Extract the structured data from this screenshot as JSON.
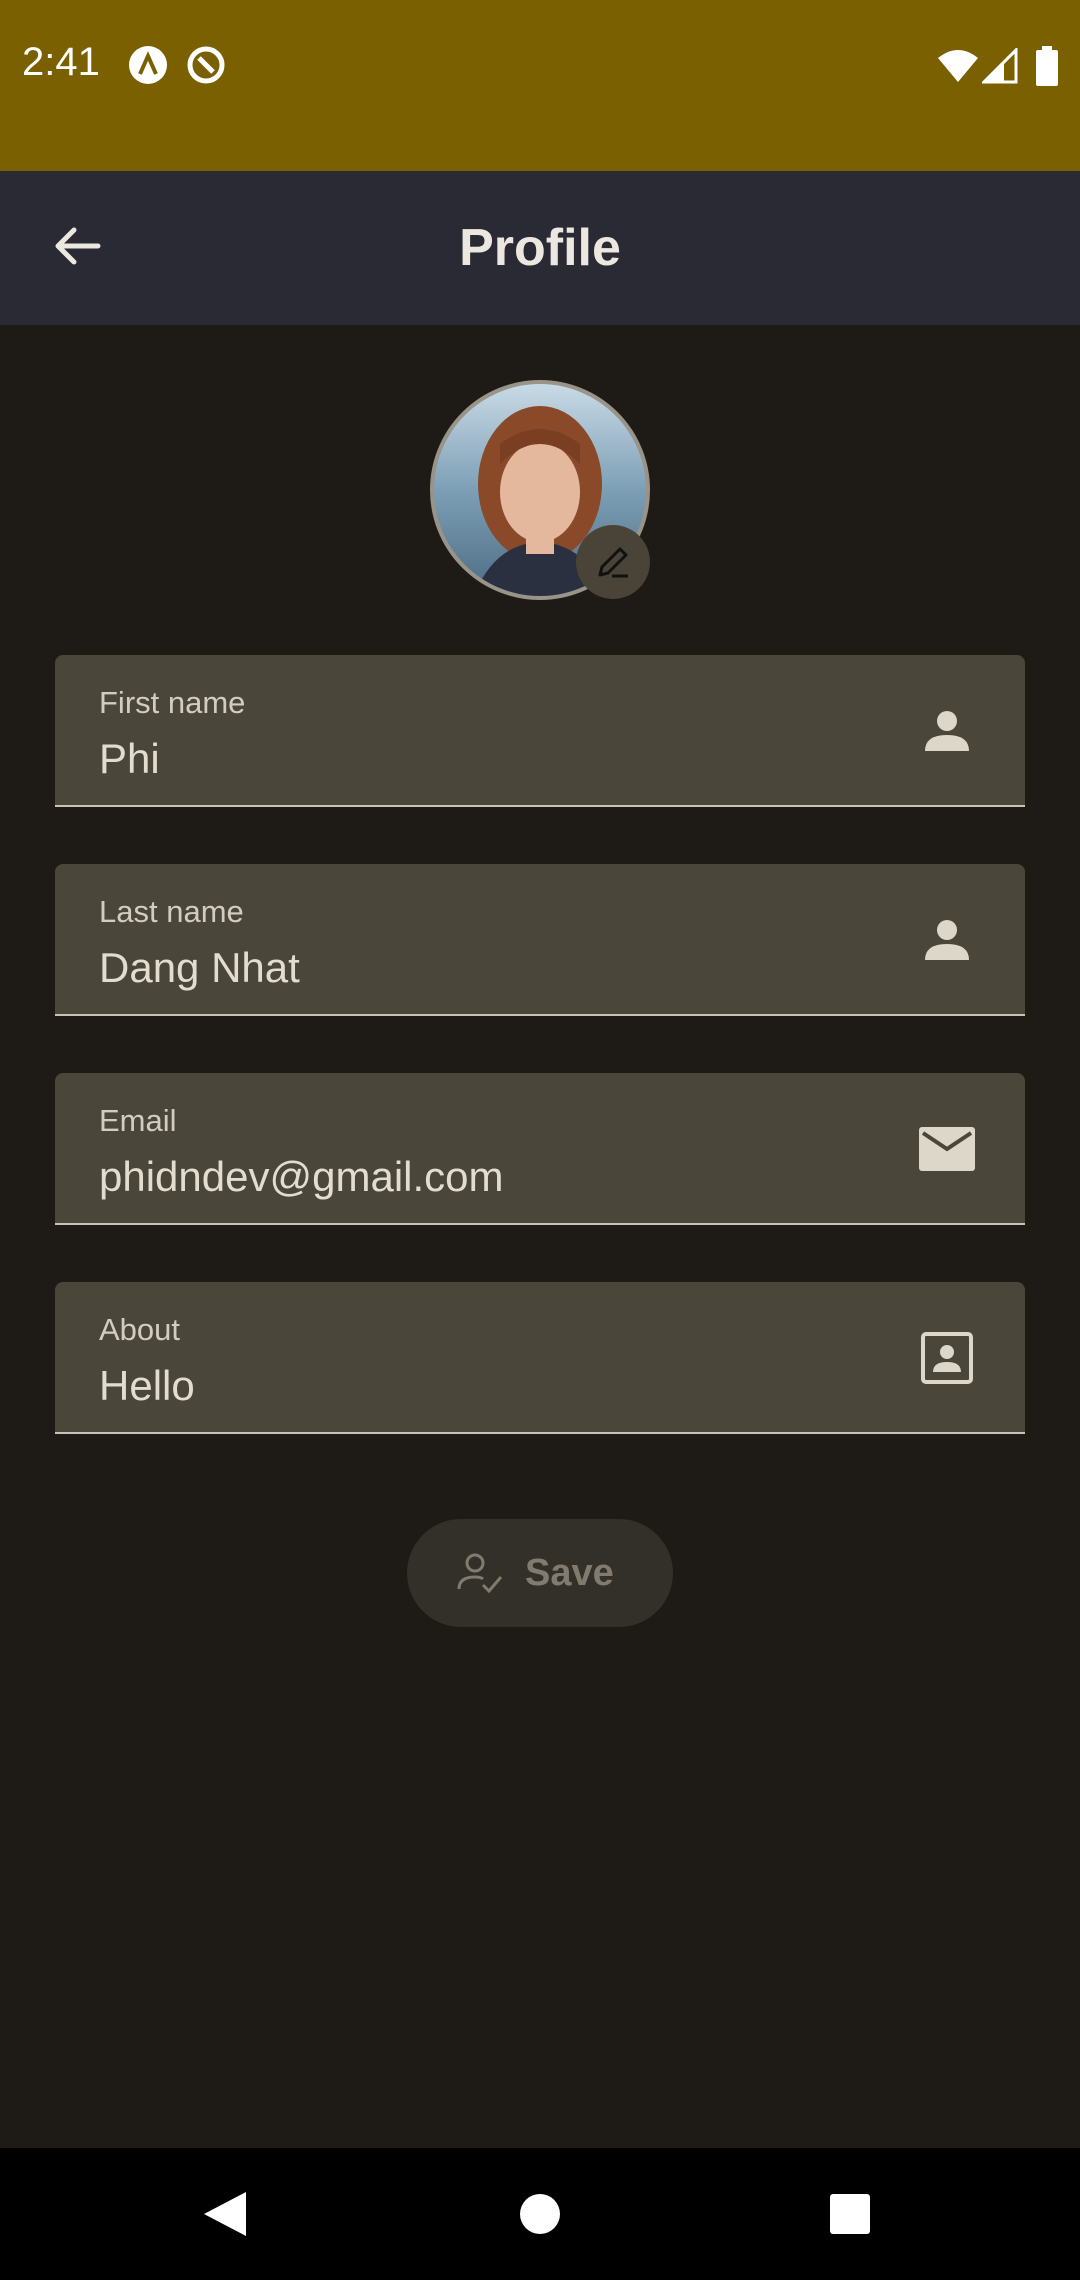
{
  "status_bar": {
    "time": "2:41",
    "icons": [
      "app-notification-icon-a",
      "app-notification-icon-b",
      "wifi-icon",
      "signal-icon",
      "battery-icon"
    ],
    "background": "#7a6000"
  },
  "app_bar": {
    "title": "Profile",
    "back_icon": "arrow-back-icon",
    "background": "#2a2a35"
  },
  "profile": {
    "avatar": "profile-photo",
    "edit_icon": "edit-pencil-icon"
  },
  "form": {
    "fields": [
      {
        "label": "First name",
        "value": "Phi",
        "icon": "person-icon"
      },
      {
        "label": "Last name",
        "value": "Dang Nhat",
        "icon": "person-icon"
      },
      {
        "label": "Email",
        "value": "phidndev@gmail.com",
        "icon": "mail-icon"
      },
      {
        "label": "About",
        "value": "Hello",
        "icon": "contact-card-icon"
      }
    ],
    "field_background": "#4b463a"
  },
  "save_button": {
    "label": "Save",
    "icon": "person-check-icon",
    "state": "disabled"
  },
  "nav_bar": {
    "icons": [
      "back-triangle-icon",
      "home-circle-icon",
      "recents-square-icon"
    ]
  }
}
